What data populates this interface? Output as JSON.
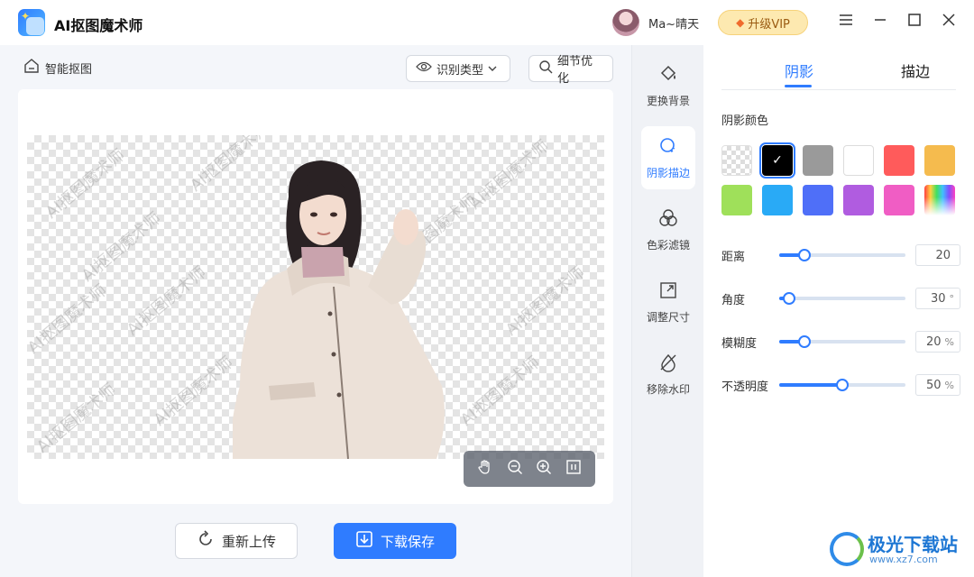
{
  "app": {
    "title": "AI抠图魔术师"
  },
  "user": {
    "name": "Ma~晴天"
  },
  "header": {
    "vip_label": "升级VIP"
  },
  "toolbar": {
    "breadcrumb": "智能抠图",
    "detect_type": "识别类型",
    "detail_opt": "细节优化"
  },
  "canvas": {
    "watermark_text": "AI抠图魔术师"
  },
  "actions": {
    "reupload": "重新上传",
    "download": "下载保存"
  },
  "tools": [
    {
      "label": "更换背景",
      "icon": "paint-bucket-icon"
    },
    {
      "label": "阴影描边",
      "icon": "shadow-icon",
      "active": true
    },
    {
      "label": "色彩滤镜",
      "icon": "color-filter-icon"
    },
    {
      "label": "调整尺寸",
      "icon": "resize-icon"
    },
    {
      "label": "移除水印",
      "icon": "remove-watermark-icon"
    }
  ],
  "panel": {
    "tabs": [
      "阴影",
      "描边"
    ],
    "active_tab": "阴影",
    "shadow_color_label": "阴影颜色",
    "colors": [
      "transparent",
      "#000000",
      "#9a9a9a",
      "#ffffff",
      "#ff5b5b",
      "#f5bb4e",
      "#9fe05a",
      "#29aaf6",
      "#4f6ff8",
      "#b05ce0",
      "#f05dc4",
      "rainbow"
    ],
    "selected_color": "#000000",
    "sliders": [
      {
        "label": "距离",
        "value": "20",
        "unit": "",
        "fraction": 0.2
      },
      {
        "label": "角度",
        "value": "30",
        "unit": "°",
        "fraction": 0.08
      },
      {
        "label": "模糊度",
        "value": "20",
        "unit": "%",
        "fraction": 0.2
      },
      {
        "label": "不透明度",
        "value": "50",
        "unit": "%",
        "fraction": 0.5
      }
    ]
  },
  "site_watermark": {
    "name": "极光下载站",
    "url": "www.xz7.com"
  },
  "colors": {
    "accent": "#2f7cff",
    "vip_bg": "#fde9b0"
  }
}
